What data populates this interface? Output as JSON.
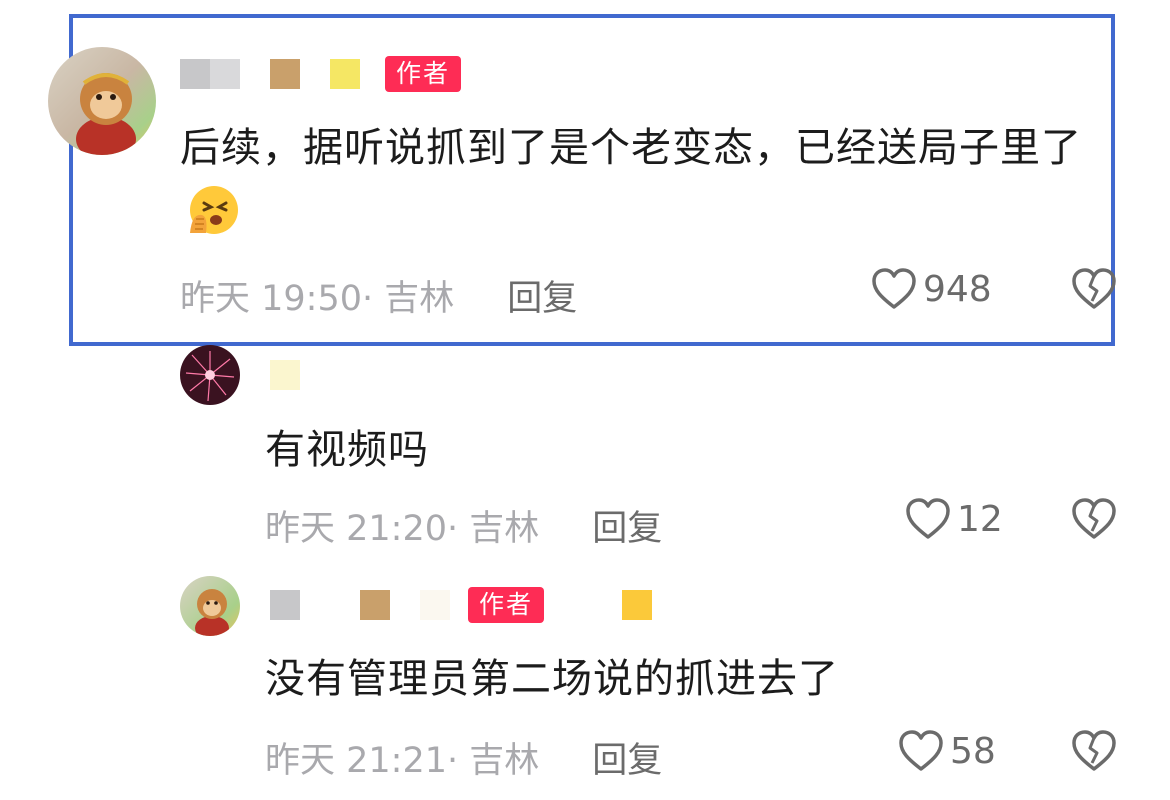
{
  "comments": [
    {
      "author_badge": "作者",
      "text": "后续，据听说抓到了是个老变态，已经送局子里了",
      "emoji": "face-with-hand-over-mouth-emoji",
      "time": "昨天 19:50",
      "location": "· 吉林",
      "reply_label": "回复",
      "like_count": "948",
      "highlighted": true
    },
    {
      "text": "有视频吗",
      "time": "昨天 21:20",
      "location": "· 吉林",
      "reply_label": "回复",
      "like_count": "12"
    },
    {
      "author_badge": "作者",
      "text": "没有管理员第二场说的抓进去了",
      "time": "昨天 21:21",
      "location": "· 吉林",
      "reply_label": "回复",
      "like_count": "58"
    }
  ],
  "colors": {
    "highlight_border": "#4169cf",
    "author_badge": "#fe2c55",
    "meta_text": "#a9a9ad",
    "action_text": "#6b6b6b"
  },
  "icons": {
    "like": "heart-outline-icon",
    "dislike": "broken-heart-icon"
  }
}
